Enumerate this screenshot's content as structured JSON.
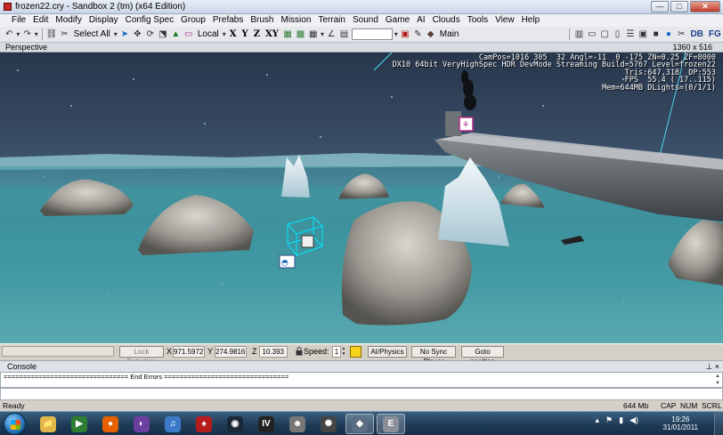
{
  "window": {
    "title": "frozen22.cry - Sandbox 2 (tm) (x64 Edition)",
    "minimize": "—",
    "maximize": "□",
    "close": "✕"
  },
  "menu": [
    "File",
    "Edit",
    "Modify",
    "Display",
    "Config Spec",
    "Group",
    "Prefabs",
    "Brush",
    "Mission",
    "Terrain",
    "Sound",
    "Game",
    "AI",
    "Clouds",
    "Tools",
    "View",
    "Help"
  ],
  "toolbar": {
    "select_all": "Select All",
    "coord_system": "Local",
    "axes": [
      "X",
      "Y",
      "Z",
      "XY"
    ],
    "layer_label": "Main",
    "icon_names": [
      "undo-icon",
      "redo-icon",
      "link-icon",
      "unlink-icon",
      "select-arrow-icon",
      "move-icon",
      "rotate-icon",
      "scale-icon",
      "terrain-snap-icon",
      "grid-icon",
      "snap-angle-icon",
      "material-icon"
    ],
    "right_icons": [
      "save-icon",
      "open-icon",
      "copy-icon",
      "clipboard-icon",
      "list-icon",
      "cube-icon",
      "toggle-icon",
      "sphere-icon",
      "scissors-icon"
    ],
    "right_labels": [
      "DB",
      "FG"
    ]
  },
  "viewport": {
    "header_label": "Perspective",
    "resolution": "1360 x 516",
    "hud_lines": [
      "CamPos=1016 305  32 Angl=-11  0 -175 ZN=0.25 ZF=8000",
      "DX10 64bit VeryHighSpec HDR DevMode Streaming Build=5767 Level=frozen22",
      "Tris:647,318  DP:553",
      "FPS  55.4 ( 17..115)",
      "Mem=644MB DLights=(0/1/1)"
    ]
  },
  "coordbar": {
    "lock_selection": "Lock Selection",
    "x_label": "X",
    "x_value": "971.5972",
    "y_label": "Y",
    "y_value": "274.9816",
    "z_label": "Z",
    "z_value": "10.393",
    "speed_label": "Speed:",
    "speed_value": "1",
    "ai_physics": "AI/Physics",
    "sync_player": "No Sync Player",
    "goto_position": "Goto position"
  },
  "console": {
    "title": "Console",
    "pin": "⊥ ×",
    "log_line": "================================ End Errors ================================"
  },
  "statusbar": {
    "ready": "Ready",
    "memory": "644 Mb",
    "caps": "CAP",
    "num": "NUM",
    "scrl": "SCRL"
  },
  "taskbar": {
    "clock_time": "19:26",
    "clock_date": "31/01/2011",
    "apps": [
      {
        "name": "explorer-app",
        "glyph": "📁",
        "color": "#e0b64a"
      },
      {
        "name": "media-center-app",
        "glyph": "▶",
        "color": "#2e7d32"
      },
      {
        "name": "firefox-app",
        "glyph": "●",
        "color": "#e66000"
      },
      {
        "name": "daemon-tools-app",
        "glyph": "◐",
        "color": "#6a3fa0"
      },
      {
        "name": "itunes-app",
        "glyph": "♫",
        "color": "#3a7ac8"
      },
      {
        "name": "bioshock-app",
        "glyph": "♠",
        "color": "#b71c1c"
      },
      {
        "name": "steam-app",
        "glyph": "◉",
        "color": "#1b2838"
      },
      {
        "name": "gta4-app",
        "glyph": "IV",
        "color": "#222"
      },
      {
        "name": "stormtrooper-app",
        "glyph": "☻",
        "color": "#777"
      },
      {
        "name": "starwars-app",
        "glyph": "✺",
        "color": "#444"
      },
      {
        "name": "sandbox-app",
        "glyph": "◆",
        "color": "#5d6f86"
      },
      {
        "name": "crysis-app",
        "glyph": "E",
        "color": "#8a8f99"
      }
    ]
  },
  "colors": {
    "selection": "#00e5ff",
    "smoke": "#0b0b0b"
  }
}
